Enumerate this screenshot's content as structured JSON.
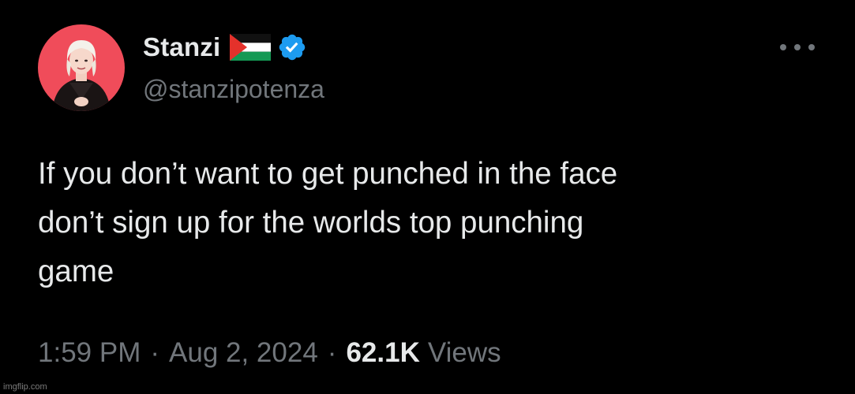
{
  "author": {
    "display_name": "Stanzi",
    "handle": "@stanzipotenza",
    "flag_icon": "palestine-flag-icon",
    "verified_icon": "verified-badge-icon",
    "verified_color": "#1d9bf0",
    "avatar_bg": "#f04c5a"
  },
  "tweet": {
    "text_lines": [
      "If you don’t want to get punched in the face",
      "don’t sign up for the worlds top punching",
      "game"
    ]
  },
  "meta": {
    "time": "1:59 PM",
    "separator": "·",
    "date": "Aug 2, 2024",
    "views_count": "62.1K",
    "views_label": "Views"
  },
  "actions": {
    "more_icon": "more-options-icon"
  },
  "watermark": "imgflip.com",
  "colors": {
    "background": "#000000",
    "primary_text": "#e7e9ea",
    "secondary_text": "#71767b"
  }
}
